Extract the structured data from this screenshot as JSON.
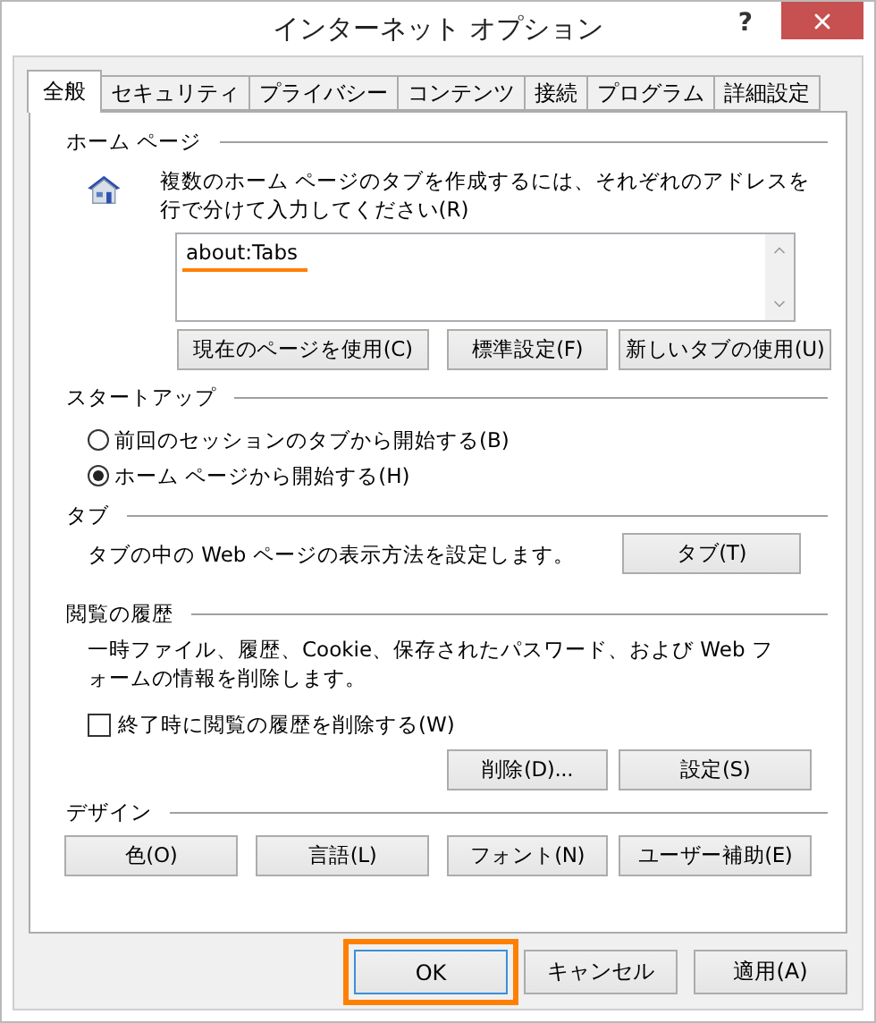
{
  "window": {
    "title": "インターネット オプション",
    "help": "?"
  },
  "tabs": [
    {
      "label": "全般",
      "selected": true
    },
    {
      "label": "セキュリティ",
      "selected": false
    },
    {
      "label": "プライバシー",
      "selected": false
    },
    {
      "label": "コンテンツ",
      "selected": false
    },
    {
      "label": "接続",
      "selected": false
    },
    {
      "label": "プログラム",
      "selected": false
    },
    {
      "label": "詳細設定",
      "selected": false
    }
  ],
  "home_page": {
    "heading": "ホーム ページ",
    "description": "複数のホーム ページのタブを作成するには、それぞれのアドレスを行で分けて入力してください(R)",
    "address": "about:Tabs",
    "address_highlighted": true,
    "buttons": [
      {
        "label": "現在のページを使用(C)"
      },
      {
        "label": "標準設定(F)"
      },
      {
        "label": "新しいタブの使用(U)"
      }
    ]
  },
  "startup": {
    "heading": "スタートアップ",
    "options": [
      {
        "label": "前回のセッションのタブから開始する(B)",
        "selected": false
      },
      {
        "label": "ホーム ページから開始する(H)",
        "selected": true
      }
    ]
  },
  "tab_section": {
    "heading": "タブ",
    "description": "タブの中の Web ページの表示方法を設定します。",
    "button": "タブ(T)"
  },
  "history": {
    "heading": "閲覧の履歴",
    "description": "一時ファイル、履歴、Cookie、保存されたパスワード、および Web フォームの情報を削除します。",
    "checkbox": {
      "label": "終了時に閲覧の履歴を削除する(W)",
      "checked": false
    },
    "buttons": [
      {
        "label": "削除(D)..."
      },
      {
        "label": "設定(S)"
      }
    ]
  },
  "design": {
    "heading": "デザイン",
    "buttons": [
      {
        "label": "色(O)"
      },
      {
        "label": "言語(L)"
      },
      {
        "label": "フォント(N)"
      },
      {
        "label": "ユーザー補助(E)"
      }
    ]
  },
  "footer": [
    {
      "label": "OK",
      "highlighted": true
    },
    {
      "label": "キャンセル",
      "highlighted": false
    },
    {
      "label": "適用(A)",
      "highlighted": false
    }
  ]
}
